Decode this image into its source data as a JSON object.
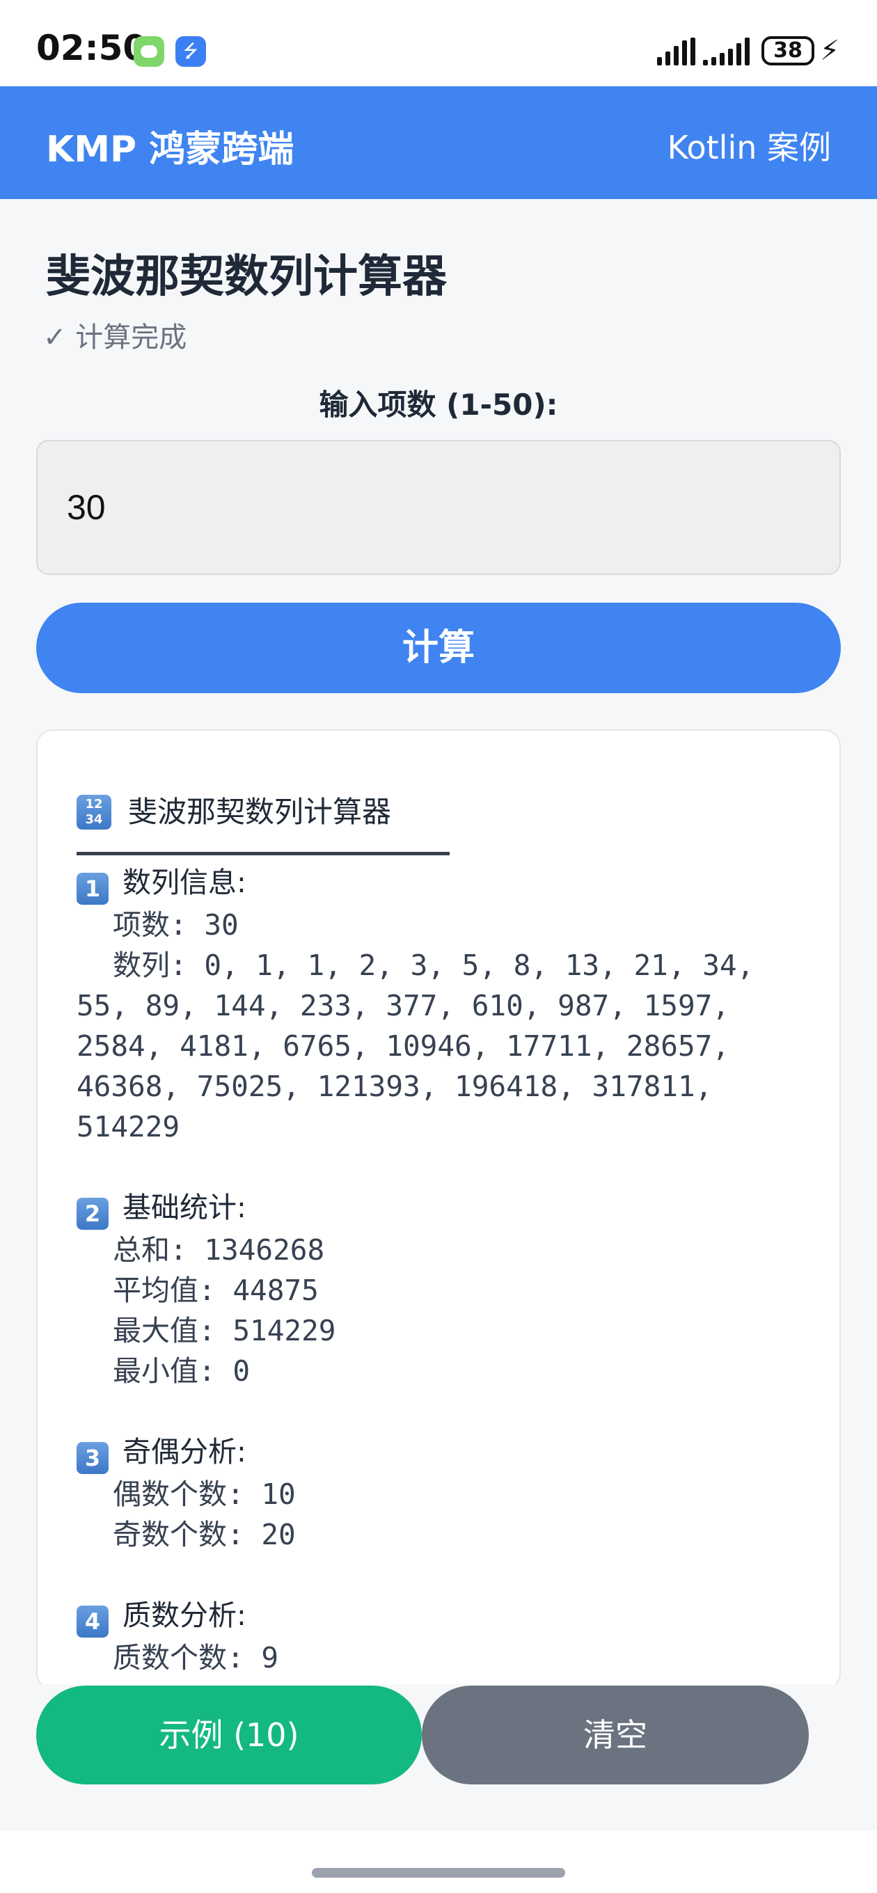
{
  "status_bar": {
    "time": "02:50",
    "battery": "38",
    "usb_glyph": "⭍"
  },
  "app_bar": {
    "title": "KMP 鸿蒙跨端",
    "subtitle": "Kotlin 案例"
  },
  "page": {
    "title": "斐波那契数列计算器",
    "status": "✓ 计算完成",
    "input_label": "输入项数 (1-50):",
    "input_value": "30",
    "calculate_label": "计算"
  },
  "result": {
    "header_icon_text": "12\n34",
    "header": "斐波那契数列计算器",
    "sections": [
      {
        "badge": "1",
        "title": "数列信息:",
        "rows": [
          "项数: 30"
        ],
        "sequence": "数列: 0, 1, 1, 2, 3, 5, 8, 13, 21, 34, 55, 89, 144, 233, 377, 610, 987, 1597, 2584, 4181, 6765, 10946, 17711, 28657, 46368, 75025, 121393, 196418, 317811, 514229"
      },
      {
        "badge": "2",
        "title": "基础统计:",
        "rows": [
          "总和: 1346268",
          "平均值: 44875",
          "最大值: 514229",
          "最小值: 0"
        ]
      },
      {
        "badge": "3",
        "title": "奇偶分析:",
        "rows": [
          "偶数个数: 10",
          "奇数个数: 20"
        ]
      },
      {
        "badge": "4",
        "title": "质数分析:",
        "rows": [
          "质数个数: 9"
        ]
      }
    ]
  },
  "actions": {
    "example_label": "示例 (10)",
    "clear_label": "清空"
  },
  "colors": {
    "primary": "#3f84f0",
    "success": "#13b981",
    "neutral": "#6b7280"
  }
}
